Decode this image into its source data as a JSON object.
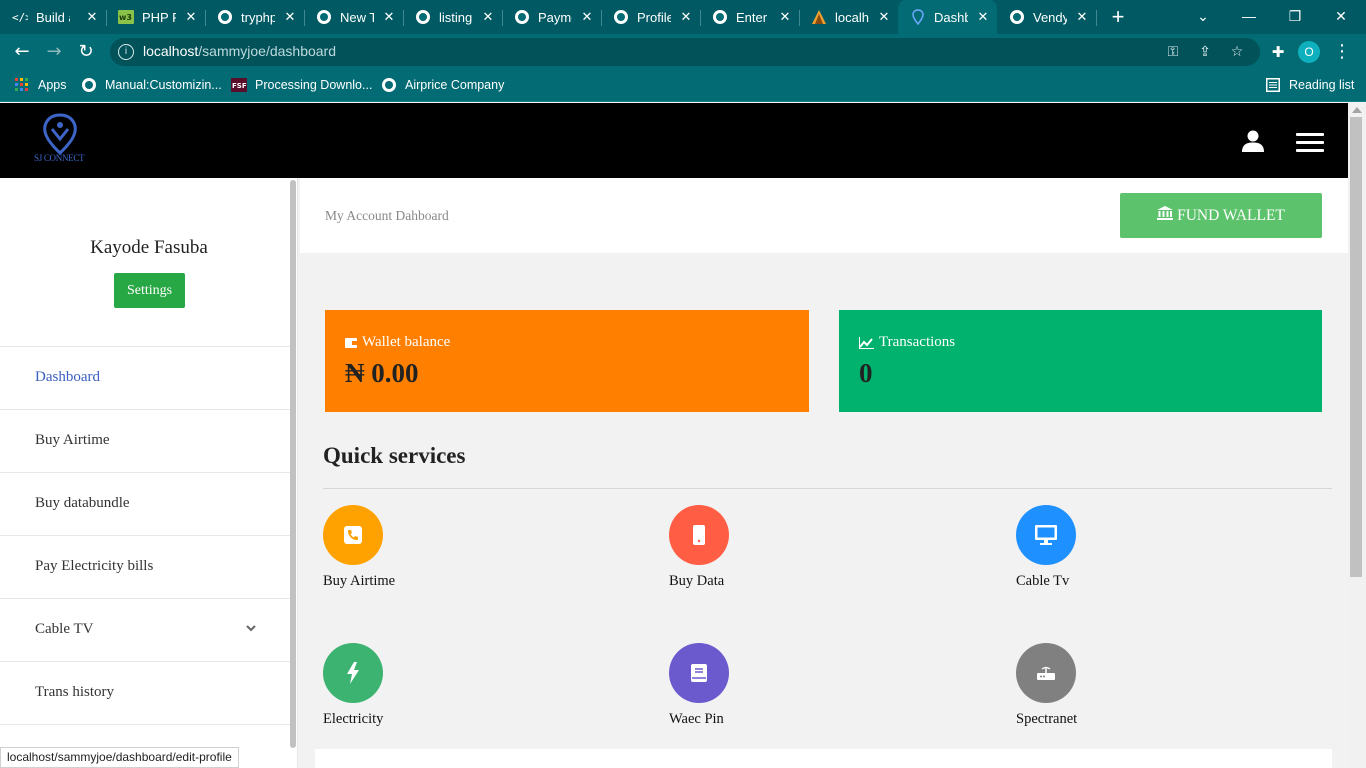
{
  "browser": {
    "tabs": [
      {
        "title": "Build a",
        "icon": "code-icon"
      },
      {
        "title": "PHP Fo",
        "icon": "php-icon"
      },
      {
        "title": "tryphp",
        "icon": "globe-icon"
      },
      {
        "title": "New Ta",
        "icon": "github-icon"
      },
      {
        "title": "listing",
        "icon": "globe-icon"
      },
      {
        "title": "Payme",
        "icon": "globe-icon"
      },
      {
        "title": "Profile",
        "icon": "globe-icon"
      },
      {
        "title": "Enter D",
        "icon": "globe-icon"
      },
      {
        "title": "localho",
        "icon": "server-icon"
      },
      {
        "title": "Dashb",
        "icon": "location-icon",
        "active": true
      },
      {
        "title": "Vendy",
        "icon": "globe-icon"
      }
    ],
    "url_host": "localhost",
    "url_path": "/sammyjoe/dashboard",
    "profile_initial": "O",
    "bookmarks": {
      "apps": "Apps",
      "items": [
        "Manual:Customizin...",
        "Processing Downlo...",
        "Airprice Company"
      ],
      "reading_list": "Reading list"
    },
    "status_url": "localhost/sammyjoe/dashboard/edit-profile"
  },
  "header": {
    "logo_text": "SJ CONNECT"
  },
  "sidebar": {
    "user_name": "Kayode Fasuba",
    "settings_label": "Settings",
    "items": [
      {
        "label": "Dashboard",
        "active": true
      },
      {
        "label": "Buy Airtime"
      },
      {
        "label": "Buy databundle"
      },
      {
        "label": "Pay Electricity bills"
      },
      {
        "label": "Cable TV",
        "has_submenu": true
      },
      {
        "label": "Trans history"
      }
    ]
  },
  "main": {
    "breadcrumb": "My Account Dahboard",
    "fund_wallet_label": "FUND WALLET",
    "wallet": {
      "label": "Wallet balance",
      "value": "₦ 0.00",
      "color": "#ff8000"
    },
    "transactions": {
      "label": "Transactions",
      "value": "0",
      "color": "#00b26d"
    },
    "quick_services_title": "Quick services",
    "services": [
      {
        "label": "Buy Airtime",
        "icon": "phone-icon",
        "color": "#ffa200"
      },
      {
        "label": "Buy Data",
        "icon": "mobile-icon",
        "color": "#ff5e44"
      },
      {
        "label": "Cable Tv",
        "icon": "monitor-icon",
        "color": "#1e90ff"
      },
      {
        "label": "Electricity",
        "icon": "bolt-icon",
        "color": "#3cb371"
      },
      {
        "label": "Waec Pin",
        "icon": "book-icon",
        "color": "#6a5acd"
      },
      {
        "label": "Spectranet",
        "icon": "router-icon",
        "color": "#808080"
      }
    ]
  }
}
